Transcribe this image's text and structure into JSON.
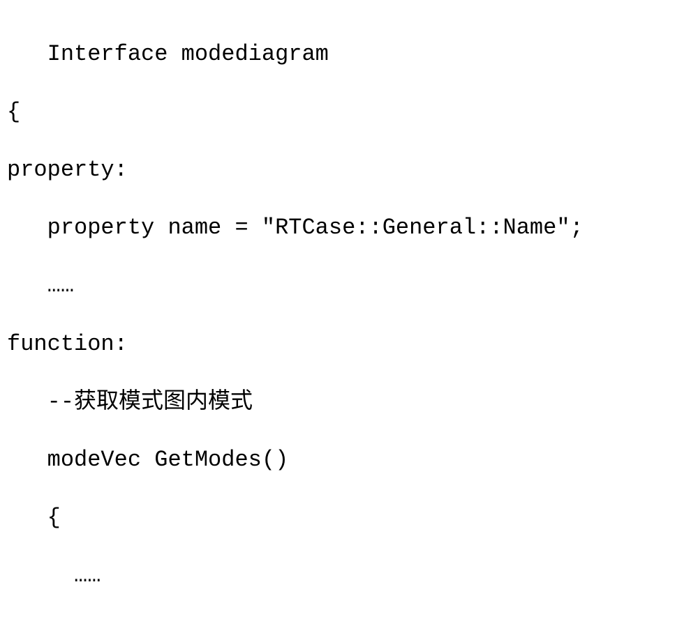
{
  "code": {
    "line1": "   Interface modediagram",
    "line2": "{",
    "line3": "property:",
    "line4": "   property name = \"RTCase::General::Name\";",
    "line5": "   ……",
    "line6": "function:",
    "line7": "   --获取模式图内模式",
    "line8": "   modeVec GetModes()",
    "line9": "   {",
    "line10": "     ……"
  }
}
